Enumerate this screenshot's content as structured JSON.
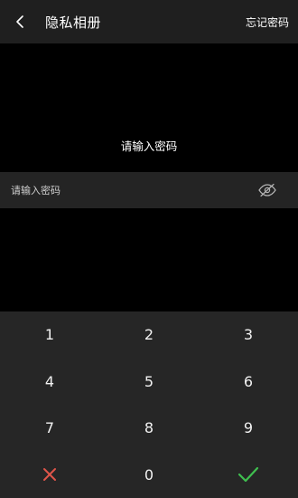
{
  "header": {
    "title": "隐私相册",
    "forgot_label": "忘记密码"
  },
  "prompt": {
    "text": "请输入密码"
  },
  "password_field": {
    "placeholder": "请输入密码",
    "value": ""
  },
  "keypad": {
    "keys": [
      "1",
      "2",
      "3",
      "4",
      "5",
      "6",
      "7",
      "8",
      "9",
      "0"
    ],
    "cancel_icon": "close-icon",
    "confirm_icon": "check-icon",
    "cancel_color": "#e0554a",
    "confirm_color": "#3fbf4f"
  },
  "colors": {
    "header_bg": "#1f1f1f",
    "input_row_bg": "#242424",
    "keypad_bg": "#262626",
    "page_bg": "#000000"
  }
}
